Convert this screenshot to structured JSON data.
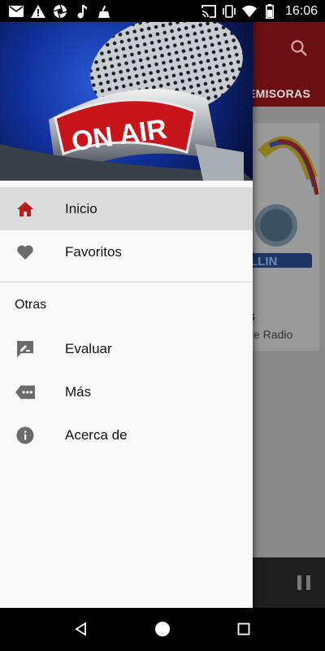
{
  "status_bar": {
    "time": "16:06",
    "left_icons": [
      "mail-icon",
      "warning-icon",
      "aperture-icon",
      "music-note-icon",
      "cleaner-icon"
    ],
    "right_icons": [
      "cast-icon",
      "vibrate-icon",
      "wifi-icon",
      "battery-icon"
    ]
  },
  "background_app": {
    "tab_label": "EMISORAS",
    "card": {
      "title": "s",
      "subtitle": "e Radio",
      "logo_text": "LLIN"
    },
    "toolbar_color": "#b71c1c"
  },
  "drawer": {
    "header_text": "ON AIR",
    "items": [
      {
        "label": "Inicio",
        "icon": "home-icon",
        "active": true
      },
      {
        "label": "Favoritos",
        "icon": "heart-icon",
        "active": false
      }
    ],
    "section_title": "Otras",
    "other_items": [
      {
        "label": "Evaluar",
        "icon": "rate-review-icon"
      },
      {
        "label": "Más",
        "icon": "more-tag-icon"
      },
      {
        "label": "Acerca de",
        "icon": "info-icon"
      }
    ],
    "accent_color": "#b71c1c"
  },
  "nav_bar": {
    "buttons": [
      "back-icon",
      "home-circle-icon",
      "recents-icon"
    ]
  }
}
